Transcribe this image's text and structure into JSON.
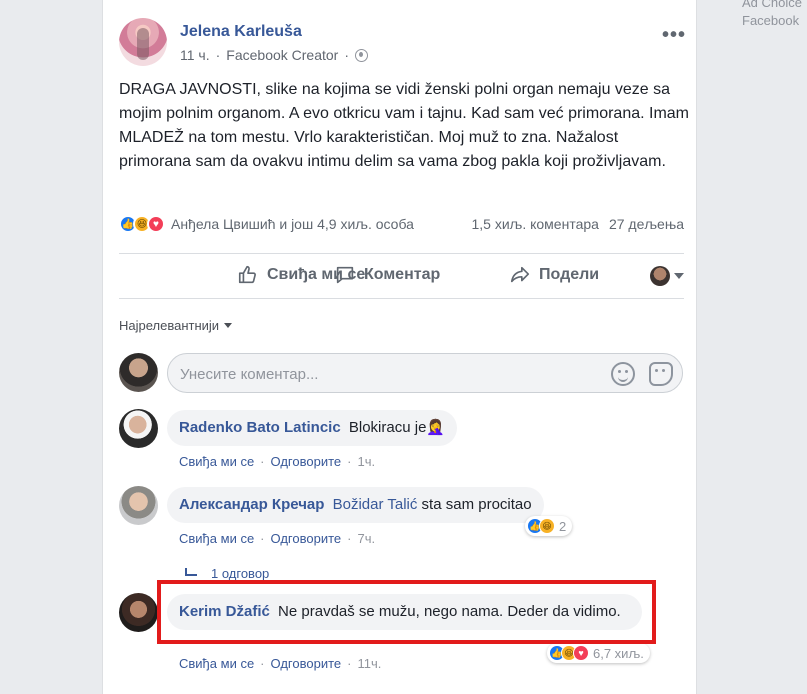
{
  "ad_choices": {
    "line1": "Ad Choice",
    "line2": "Facebook"
  },
  "post": {
    "author": "Jelena Karleuša",
    "time": "11 ч.",
    "separator": "·",
    "via": "Facebook Creator",
    "text": "DRAGA JAVNOSTI, slike na kojima se vidi ženski polni organ nemaju veze sa mojim polnim organom. A evo otkricu vam i tajnu. Kad sam već primorana. Imam MLADEŽ na tom mestu. Vrlo karakterističan. Moj muž to zna. Nažalost primorana sam da ovakvu intimu delim sa vama zbog pakla koji proživljavam.",
    "reaction_summary": "Анђела Цвишић и још 4,9 хиљ. особа",
    "comments_count": "1,5 хиљ. коментара",
    "shares_count": "27 дељења",
    "reaction_icons": [
      "like-icon",
      "haha-icon",
      "love-icon"
    ]
  },
  "actions": {
    "like": "Свиђа ми се",
    "comment": "Коментар",
    "share": "Подели"
  },
  "sort_label": "Најрелевантнији",
  "composer": {
    "placeholder": "Унесите коментар..."
  },
  "comments": [
    {
      "name": "Radenko Bato Latincic",
      "text": "Blokiracu je🤦‍♀️",
      "like": "Свиђа ми се",
      "reply": "Одговорите",
      "time": "1ч."
    },
    {
      "name": "Александар Кречар",
      "mention": "Božidar Talić",
      "text": "sta sam procitao",
      "like": "Свиђа ми се",
      "reply": "Одговорите",
      "time": "7ч.",
      "reactions": "2",
      "replies_link": "1 одговор"
    },
    {
      "name": "Kerim Džafić",
      "text": "Ne pravdaš se mužu, nego nama. Deder da vidimo.",
      "like": "Свиђа ми се",
      "reply": "Одговорите",
      "time": "11ч.",
      "reactions": "6,7 хиљ."
    }
  ],
  "colors": {
    "link": "#385898",
    "highlight_border": "#e21b1b",
    "like_blue": "#1877f2",
    "haha_yellow": "#f7b125",
    "love_red": "#f33e58"
  }
}
